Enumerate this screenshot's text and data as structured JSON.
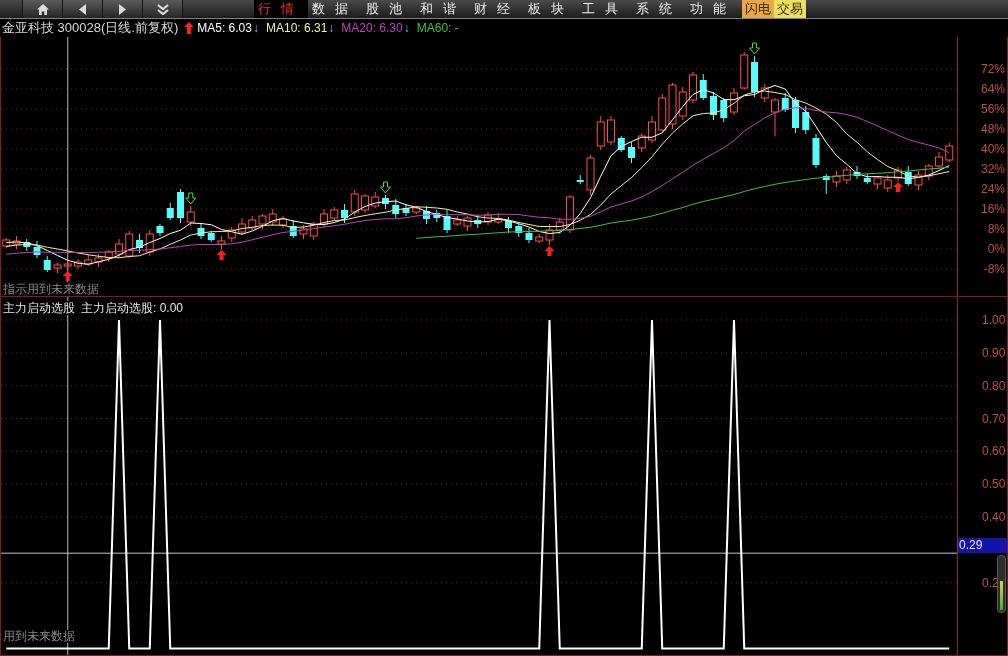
{
  "toolbar": {
    "nav_buttons": [
      {
        "kind": "home"
      },
      {
        "kind": "back"
      },
      {
        "kind": "forward"
      },
      {
        "kind": "more"
      }
    ],
    "menu": [
      {
        "label": "行情",
        "selected": true
      },
      {
        "label": "数据",
        "selected": false
      },
      {
        "label": "股池",
        "selected": false
      },
      {
        "label": "和谐",
        "selected": false
      },
      {
        "label": "财经",
        "selected": false
      },
      {
        "label": "板块",
        "selected": false
      },
      {
        "label": "工具",
        "selected": false
      },
      {
        "label": "系统",
        "selected": false
      },
      {
        "label": "功能",
        "selected": false
      }
    ],
    "quick_buttons": [
      {
        "label": "闪电",
        "color": "#e8a848"
      },
      {
        "label": "交易",
        "color": "#ece060"
      }
    ]
  },
  "chart_header": {
    "title": "金亚科技 300028(日线.前复权)",
    "moving_averages": [
      {
        "label": "MA5: 6.03",
        "color": "#ffffff",
        "arrow": "↓"
      },
      {
        "label": "MA10: 6.31",
        "color": "#f0f0a0",
        "arrow": "↓"
      },
      {
        "label": "MA20: 6.30",
        "color": "#c040c0",
        "arrow": "↓"
      },
      {
        "label": "MA60: -",
        "color": "#40c040"
      }
    ]
  },
  "price_chart": {
    "note": "指示用到未来数据",
    "chart_data": {
      "type": "candlestick",
      "ylim": [
        -18.8,
        84.8
      ],
      "grid": true,
      "yticks": [
        {
          "value": 72,
          "label": "72%"
        },
        {
          "value": 64,
          "label": "64%"
        },
        {
          "value": 56,
          "label": "56%"
        },
        {
          "value": 48,
          "label": "48%"
        },
        {
          "value": 40,
          "label": "40%"
        },
        {
          "value": 32,
          "label": "32%"
        },
        {
          "value": 24,
          "label": "24%"
        },
        {
          "value": 16,
          "label": "16%"
        },
        {
          "value": 8,
          "label": "8%"
        },
        {
          "value": 0,
          "label": "0%"
        },
        {
          "value": -8,
          "label": "-8%"
        }
      ],
      "ohlc": [
        [
          1.2,
          4.4,
          0.4,
          3.6
        ],
        [
          2.0,
          5.2,
          0.0,
          3.2
        ],
        [
          2.8,
          4.0,
          -0.8,
          0.8
        ],
        [
          0.8,
          3.2,
          -3.6,
          -2.4
        ],
        [
          -4.4,
          -2.8,
          -9.2,
          -8.4
        ],
        [
          -7.6,
          -5.6,
          -9.6,
          -6.4
        ],
        [
          -6.8,
          -4.0,
          -8.4,
          -6.0
        ],
        [
          -6.8,
          -4.0,
          -8.0,
          -5.2
        ],
        [
          -6.0,
          -2.0,
          -6.8,
          -4.4
        ],
        [
          -5.2,
          -2.0,
          -7.2,
          -3.6
        ],
        [
          -3.6,
          -0.4,
          -5.2,
          -1.2
        ],
        [
          -2.0,
          4.0,
          -3.2,
          2.0
        ],
        [
          -2.8,
          7.2,
          -3.6,
          6.0
        ],
        [
          3.6,
          6.0,
          -1.6,
          0.4
        ],
        [
          -1.2,
          7.6,
          -2.8,
          6.0
        ],
        [
          9.2,
          10.0,
          5.2,
          6.4
        ],
        [
          16.4,
          18.4,
          11.6,
          12.4
        ],
        [
          22.8,
          24.0,
          10.4,
          12.4
        ],
        [
          10.8,
          17.2,
          9.2,
          14.8
        ],
        [
          8.4,
          10.0,
          4.0,
          5.2
        ],
        [
          6.4,
          7.2,
          2.8,
          3.6
        ],
        [
          2.0,
          5.2,
          0.0,
          3.2
        ],
        [
          4.4,
          8.8,
          2.8,
          7.6
        ],
        [
          6.8,
          12.4,
          5.6,
          10.0
        ],
        [
          8.4,
          13.2,
          7.6,
          11.6
        ],
        [
          10.0,
          14.0,
          8.0,
          13.2
        ],
        [
          10.8,
          16.0,
          9.2,
          14.0
        ],
        [
          9.6,
          13.2,
          8.4,
          12.0
        ],
        [
          9.2,
          11.6,
          4.4,
          5.2
        ],
        [
          6.0,
          9.6,
          4.0,
          8.0
        ],
        [
          5.2,
          10.8,
          3.6,
          10.0
        ],
        [
          10.0,
          16.0,
          8.8,
          14.0
        ],
        [
          12.4,
          16.8,
          11.6,
          15.6
        ],
        [
          15.6,
          18.0,
          10.4,
          12.4
        ],
        [
          14.8,
          23.6,
          13.2,
          22.0
        ],
        [
          15.6,
          22.0,
          14.4,
          21.2
        ],
        [
          17.2,
          22.8,
          16.4,
          20.8
        ],
        [
          20.4,
          21.6,
          16.0,
          18.0
        ],
        [
          17.6,
          20.0,
          12.4,
          14.0
        ],
        [
          16.4,
          18.0,
          13.2,
          14.4
        ],
        [
          14.8,
          17.2,
          14.0,
          16.4
        ],
        [
          15.2,
          17.2,
          10.0,
          12.0
        ],
        [
          14.4,
          15.6,
          10.8,
          12.4
        ],
        [
          13.2,
          15.6,
          6.4,
          7.6
        ],
        [
          10.0,
          13.2,
          9.2,
          11.6
        ],
        [
          9.2,
          13.2,
          7.2,
          12.4
        ],
        [
          11.6,
          13.6,
          8.4,
          10.0
        ],
        [
          10.8,
          14.8,
          9.6,
          13.6
        ],
        [
          10.8,
          14.4,
          10.0,
          12.0
        ],
        [
          11.2,
          12.8,
          6.4,
          8.4
        ],
        [
          9.2,
          10.0,
          4.8,
          6.4
        ],
        [
          6.4,
          8.4,
          2.4,
          3.6
        ],
        [
          3.2,
          6.0,
          2.4,
          4.8
        ],
        [
          3.6,
          10.0,
          1.6,
          7.6
        ],
        [
          7.6,
          12.4,
          6.0,
          10.8
        ],
        [
          7.6,
          21.6,
          6.4,
          20.8
        ],
        [
          27.6,
          29.6,
          26.0,
          26.8
        ],
        [
          23.6,
          37.6,
          21.6,
          36.4
        ],
        [
          41.2,
          53.2,
          39.6,
          50.8
        ],
        [
          42.8,
          53.2,
          41.6,
          51.6
        ],
        [
          44.4,
          45.2,
          38.8,
          39.6
        ],
        [
          40.8,
          42.8,
          34.4,
          36.4
        ],
        [
          40.4,
          46.4,
          38.8,
          45.2
        ],
        [
          43.6,
          53.2,
          42.4,
          50.8
        ],
        [
          47.6,
          62.0,
          46.8,
          60.4
        ],
        [
          50.0,
          66.4,
          48.0,
          65.6
        ],
        [
          53.2,
          64.8,
          51.6,
          62.8
        ],
        [
          59.6,
          70.8,
          58.4,
          69.6
        ],
        [
          67.6,
          70.0,
          59.6,
          60.4
        ],
        [
          61.2,
          62.8,
          51.6,
          53.6
        ],
        [
          59.6,
          60.4,
          50.8,
          52.4
        ],
        [
          54.8,
          64.4,
          53.6,
          62.4
        ],
        [
          64.4,
          78.8,
          63.6,
          77.6
        ],
        [
          74.8,
          77.2,
          60.8,
          62.8
        ],
        [
          60.4,
          66.0,
          58.8,
          64.4
        ],
        [
          54.8,
          60.4,
          45.0,
          59.6
        ],
        [
          60.4,
          62.4,
          54.8,
          55.6
        ],
        [
          59.6,
          60.8,
          46.4,
          48.4
        ],
        [
          54.8,
          57.2,
          46.0,
          47.6
        ],
        [
          44.4,
          46.0,
          32.4,
          33.6
        ],
        [
          29.2,
          30.0,
          22.0,
          27.6
        ],
        [
          26.8,
          31.2,
          24.8,
          29.2
        ],
        [
          27.6,
          32.8,
          26.0,
          31.6
        ],
        [
          30.8,
          33.2,
          28.0,
          29.2
        ],
        [
          28.4,
          30.0,
          26.0,
          26.8
        ],
        [
          26.0,
          29.2,
          24.0,
          28.4
        ],
        [
          24.4,
          29.6,
          22.8,
          27.6
        ],
        [
          28.4,
          32.8,
          27.2,
          31.6
        ],
        [
          30.8,
          33.2,
          25.2,
          26.0
        ],
        [
          25.6,
          31.2,
          23.6,
          29.6
        ],
        [
          29.2,
          34.0,
          27.6,
          33.2
        ],
        [
          33.2,
          38.8,
          32.0,
          36.8
        ],
        [
          35.6,
          42.4,
          34.8,
          41.2
        ]
      ],
      "series": [
        {
          "type": "line",
          "color": "#ffffff",
          "values": [
            2.6,
            2.8,
            2.5,
            1.4,
            -0.6,
            -2.6,
            -4.5,
            -5.7,
            -6.1,
            -5.1,
            -4.1,
            -2.5,
            -0.2,
            0.7,
            2.6,
            4.2,
            6.2,
            7.5,
            10.4,
            10.2,
            9.7,
            7.8,
            6.9,
            5.9,
            7.2,
            9.1,
            11.3,
            12.2,
            11.2,
            10.5,
            9.8,
            9.8,
            10.6,
            12.0,
            14.8,
            17.0,
            18.4,
            18.9,
            19.2,
            17.7,
            16.7,
            15.0,
            13.8,
            12.6,
            12.0,
            11.2,
            10.8,
            11.0,
            11.9,
            11.3,
            10.1,
            8.8,
            7.0,
            6.2,
            6.6,
            9.5,
            14.2,
            20.5,
            29.1,
            37.3,
            41.0,
            43.0,
            44.7,
            44.7,
            46.5,
            51.7,
            57.0,
            61.8,
            63.8,
            62.4,
            59.8,
            59.7,
            61.3,
            61.8,
            63.9,
            65.4,
            64.0,
            58.2,
            55.1,
            49.0,
            42.6,
            37.3,
            33.9,
            30.2,
            28.9,
            29.0,
            28.7,
            28.7,
            28.1,
            28.6,
            29.6,
            31.4,
            33.4
          ]
        },
        {
          "type": "line",
          "color": "#f0f0a0",
          "values": [
            1.0,
            1.6,
            1.8,
            1.6,
            0.7,
            0.0,
            -0.8,
            -1.6,
            -2.3,
            -2.9,
            -3.4,
            -3.5,
            -3.0,
            -2.7,
            -1.2,
            0.0,
            1.9,
            3.6,
            5.6,
            6.4,
            6.9,
            7.0,
            7.2,
            8.2,
            8.7,
            9.4,
            9.6,
            9.5,
            8.6,
            8.8,
            9.5,
            10.6,
            11.4,
            11.6,
            12.6,
            13.4,
            14.1,
            14.7,
            15.6,
            16.2,
            16.9,
            16.7,
            16.4,
            15.9,
            14.8,
            14.0,
            12.9,
            12.4,
            12.2,
            11.6,
            10.6,
            9.8,
            9.0,
            9.0,
            9.0,
            9.8,
            11.5,
            13.8,
            17.6,
            22.0,
            25.3,
            28.6,
            32.6,
            36.9,
            41.9,
            46.4,
            50.0,
            53.3,
            54.2,
            54.4,
            55.7,
            58.3,
            61.6,
            62.8,
            63.2,
            62.6,
            61.8,
            59.7,
            58.4,
            56.4,
            54.0,
            50.6,
            46.0,
            42.7,
            38.9,
            35.8,
            33.0,
            31.3,
            29.2,
            28.8,
            29.3,
            30.1,
            31.0
          ]
        },
        {
          "type": "line",
          "color": "#c040c0",
          "values": [
            -2.1,
            -1.7,
            -1.4,
            -1.2,
            -1.3,
            -1.3,
            -1.4,
            -1.4,
            -1.4,
            -1.3,
            -1.2,
            -0.9,
            -0.6,
            -0.5,
            -0.3,
            0.0,
            0.5,
            1.0,
            1.6,
            1.8,
            1.8,
            1.8,
            2.1,
            2.7,
            3.7,
            4.7,
            5.7,
            6.6,
            7.1,
            7.6,
            8.2,
            8.8,
            9.3,
            9.9,
            10.7,
            11.4,
            11.8,
            12.1,
            12.1,
            12.5,
            13.2,
            13.6,
            13.9,
            13.7,
            13.7,
            13.7,
            13.5,
            13.6,
            13.9,
            13.9,
            13.8,
            13.2,
            12.7,
            12.5,
            11.9,
            11.9,
            12.2,
            13.1,
            14.9,
            16.8,
            18.0,
            19.2,
            20.8,
            23.0,
            25.4,
            28.1,
            30.7,
            33.5,
            35.9,
            38.2,
            40.5,
            43.4,
            47.1,
            49.8,
            52.5,
            54.5,
            55.9,
            56.5,
            56.3,
            55.4,
            54.8,
            54.5,
            53.8,
            52.7,
            51.0,
            49.2,
            47.4,
            45.5,
            43.8,
            42.6,
            41.6,
            40.4,
            38.5
          ]
        },
        {
          "type": "line",
          "color": "#40c040",
          "values": [
            null,
            null,
            null,
            null,
            null,
            null,
            null,
            null,
            null,
            null,
            null,
            null,
            null,
            null,
            null,
            null,
            null,
            null,
            null,
            null,
            null,
            null,
            null,
            null,
            null,
            null,
            null,
            null,
            null,
            null,
            null,
            null,
            null,
            null,
            null,
            null,
            null,
            null,
            null,
            null,
            4.3,
            4.6,
            4.9,
            5.1,
            5.4,
            5.7,
            5.9,
            6.2,
            6.5,
            6.8,
            6.9,
            7.0,
            7.1,
            7.3,
            7.4,
            7.8,
            8.2,
            8.7,
            9.5,
            10.4,
            11.0,
            11.5,
            12.3,
            13.2,
            14.3,
            15.5,
            16.6,
            17.9,
            19.0,
            19.9,
            20.8,
            21.8,
            23.0,
            24.1,
            25.0,
            25.9,
            26.6,
            27.2,
            27.8,
            28.3,
            28.7,
            29.1,
            29.5,
            29.8,
            30.1,
            30.3,
            30.5,
            30.9,
            31.2,
            31.6,
            32.0,
            32.3,
            32.8
          ]
        }
      ]
    }
  },
  "indicator": {
    "reading": "主力启动选股: 0.00",
    "note": "用到未来数据",
    "chart_data": {
      "type": "line",
      "title": "主力启动选股",
      "ylim": [
        -0.02,
        1.07
      ],
      "grid": true,
      "yticks": [
        {
          "value": 1,
          "label": "1.00"
        },
        {
          "value": 0.9,
          "label": "0.90"
        },
        {
          "value": 0.8,
          "label": "0.80"
        },
        {
          "value": 0.7,
          "label": "0.70"
        },
        {
          "value": 0.6,
          "label": "0.60"
        },
        {
          "value": 0.5,
          "label": "0.50"
        },
        {
          "value": 0.4,
          "label": "0.40"
        },
        {
          "value": 0.2,
          "label": "0.2"
        }
      ],
      "ref_lines": [
        {
          "axis": "y",
          "value": 0.29,
          "label": "0.29"
        }
      ],
      "series": [
        {
          "color": "#ffffff",
          "values": [
            0,
            0,
            0,
            0,
            0,
            0,
            0,
            0,
            0,
            0,
            0,
            1,
            0,
            0,
            0,
            1,
            0,
            0,
            0,
            0,
            0,
            0,
            0,
            0,
            0,
            0,
            0,
            0,
            0,
            0,
            0,
            0,
            0,
            0,
            0,
            0,
            0,
            0,
            0,
            0,
            0,
            0,
            0,
            0,
            0,
            0,
            0,
            0,
            0,
            0,
            0,
            0,
            0,
            1,
            0,
            0,
            0,
            0,
            0,
            0,
            0,
            0,
            0,
            1,
            0,
            0,
            0,
            0,
            0,
            0,
            0,
            1,
            0,
            0,
            0,
            0,
            0,
            0,
            0,
            0,
            0,
            0,
            0,
            0,
            0,
            0,
            0,
            0,
            0,
            0,
            0,
            0,
            0
          ]
        }
      ]
    }
  }
}
